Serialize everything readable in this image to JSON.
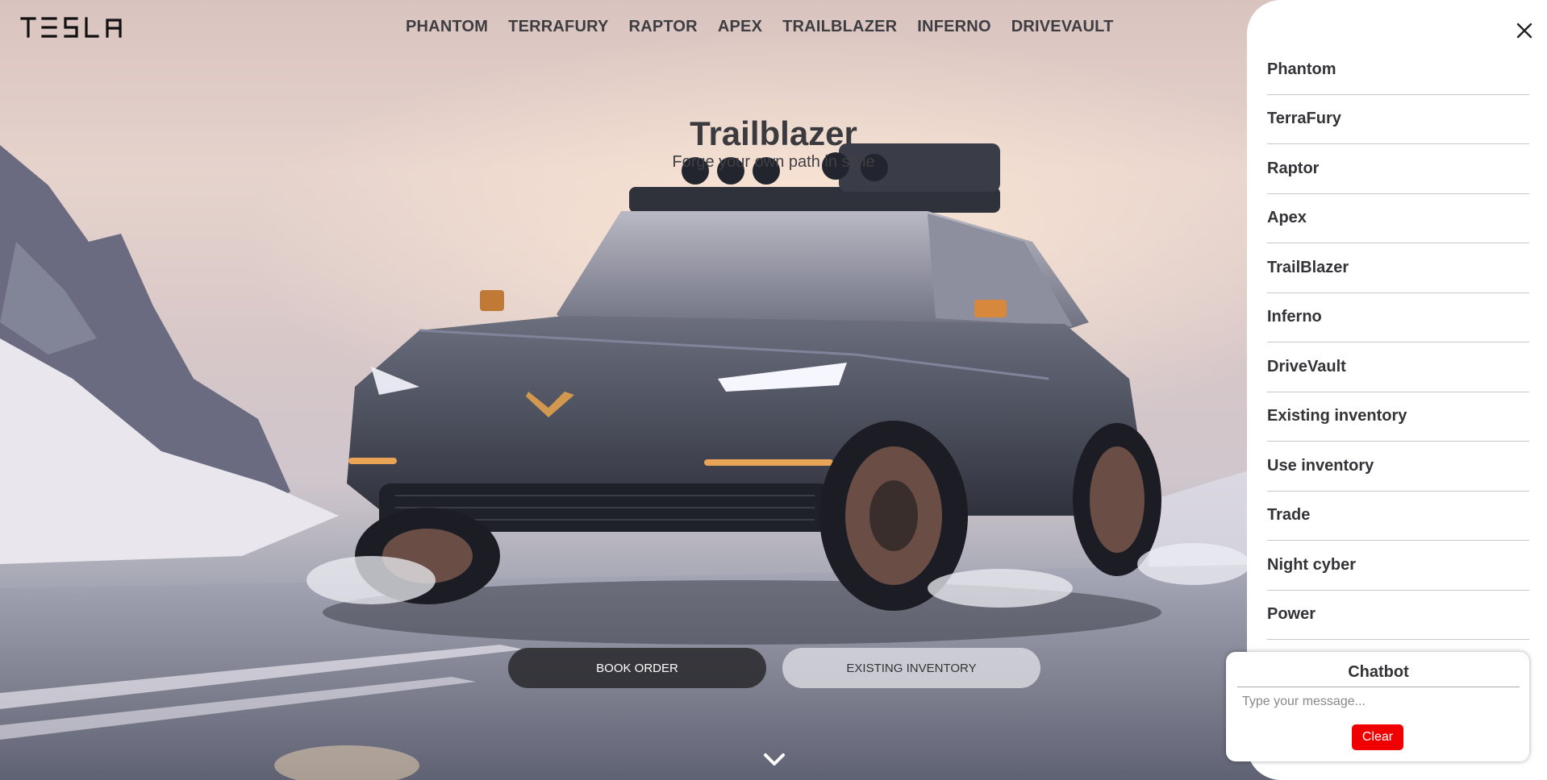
{
  "brand": {
    "logo_text": "TESLA"
  },
  "topnav": {
    "items": [
      "PHANTOM",
      "TERRAFURY",
      "RAPTOR",
      "APEX",
      "TRAILBLAZER",
      "INFERNO",
      "DRIVEVAULT"
    ]
  },
  "hero": {
    "title": "Trailblazer",
    "subtitle": "Forge your own path in style"
  },
  "buttons": {
    "book_order": "BOOK ORDER",
    "existing_inventory": "EXISTING INVENTORY"
  },
  "sidemenu": {
    "items": [
      "Phantom",
      "TerraFury",
      "Raptor",
      "Apex",
      "TrailBlazer",
      "Inferno",
      "DriveVault",
      "Existing inventory",
      "Use inventory",
      "Trade",
      "Night cyber",
      "Power"
    ]
  },
  "chatbot": {
    "title": "Chatbot",
    "placeholder": "Type your message...",
    "clear_label": "Clear"
  },
  "colors": {
    "clear_button": "#f00000",
    "nav_text": "#3d3d42",
    "dark_button": "#28282c"
  },
  "icons": {
    "close": "close-icon",
    "scroll_down": "chevron-down-icon"
  }
}
